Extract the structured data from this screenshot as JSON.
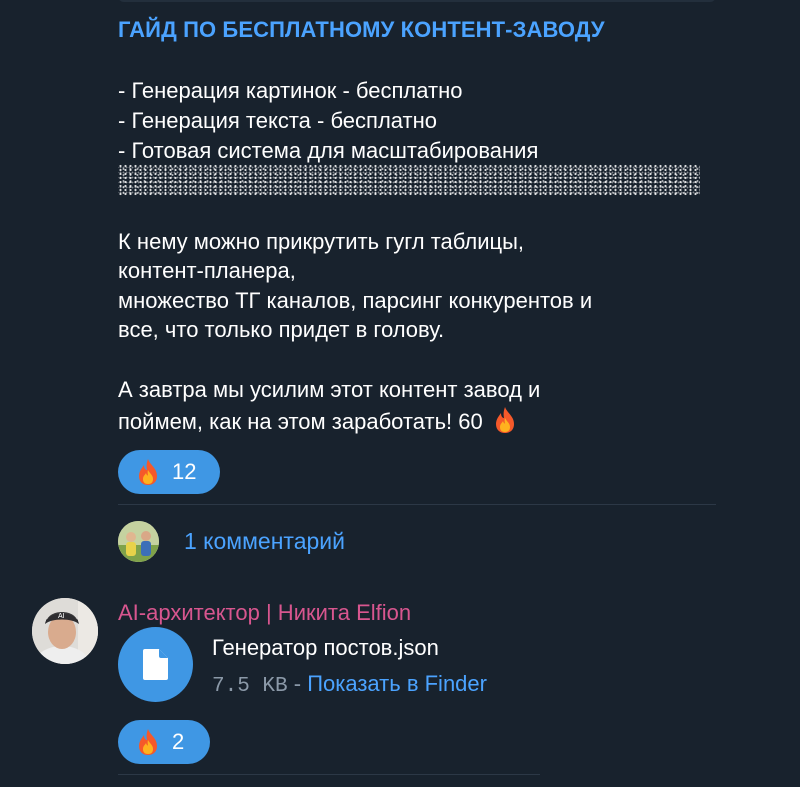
{
  "post": {
    "title": "ГАЙД ПО БЕСПЛАТНОМУ КОНТЕНТ-ЗАВОДУ",
    "lines": [
      "- Генерация картинок - бесплатно",
      "- Генерация текста - бесплатно",
      "- Готовая система для масштабирования",
      "К нему можно прикрутить гугл таблицы,",
      "контент-планера,",
      "множество ТГ каналов, парсинг конкурентов и",
      "все, что только придет в голову.",
      "А завтра мы усилим этот контент завод и",
      "поймем, как на этом заработать! 60"
    ],
    "reaction": {
      "emoji": "fire-icon",
      "count": "12"
    }
  },
  "comments": {
    "label": "1 комментарий"
  },
  "reply": {
    "author": "AI-архитектор | Никита Elfion",
    "file": {
      "name": "Генератор постов.json",
      "size": "7.5 KB",
      "separator": " - ",
      "action": "Показать в Finder"
    },
    "reaction": {
      "emoji": "fire-icon",
      "count": "2"
    }
  },
  "colors": {
    "background": "#18222d",
    "accent": "#4ba3ff",
    "reaction_bg": "#3f97e4",
    "author_name": "#d8568f"
  }
}
